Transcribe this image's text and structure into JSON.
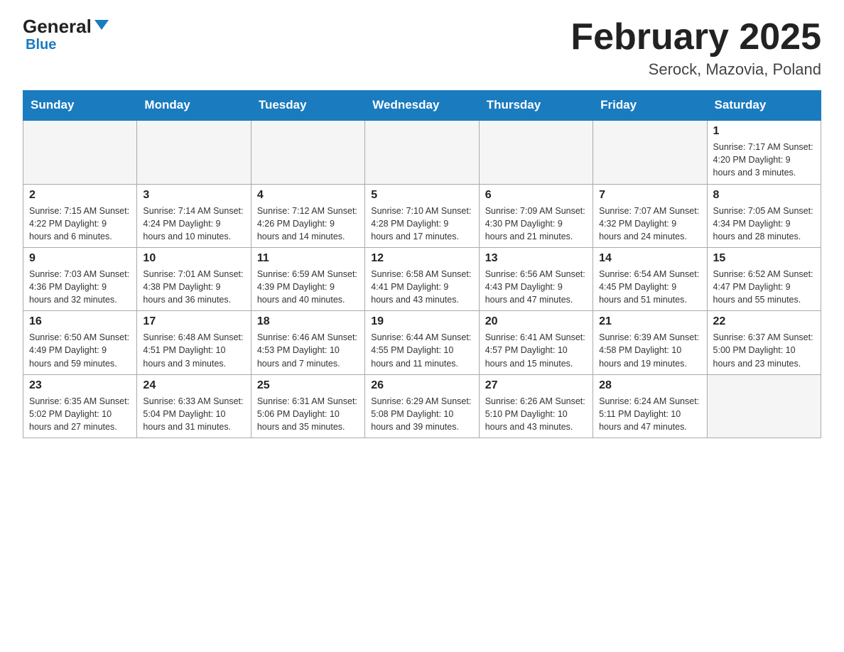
{
  "logo": {
    "name_black": "General",
    "name_blue": "Blue"
  },
  "title": "February 2025",
  "subtitle": "Serock, Mazovia, Poland",
  "days_of_week": [
    "Sunday",
    "Monday",
    "Tuesday",
    "Wednesday",
    "Thursday",
    "Friday",
    "Saturday"
  ],
  "weeks": [
    [
      {
        "day": "",
        "info": ""
      },
      {
        "day": "",
        "info": ""
      },
      {
        "day": "",
        "info": ""
      },
      {
        "day": "",
        "info": ""
      },
      {
        "day": "",
        "info": ""
      },
      {
        "day": "",
        "info": ""
      },
      {
        "day": "1",
        "info": "Sunrise: 7:17 AM\nSunset: 4:20 PM\nDaylight: 9 hours and 3 minutes."
      }
    ],
    [
      {
        "day": "2",
        "info": "Sunrise: 7:15 AM\nSunset: 4:22 PM\nDaylight: 9 hours and 6 minutes."
      },
      {
        "day": "3",
        "info": "Sunrise: 7:14 AM\nSunset: 4:24 PM\nDaylight: 9 hours and 10 minutes."
      },
      {
        "day": "4",
        "info": "Sunrise: 7:12 AM\nSunset: 4:26 PM\nDaylight: 9 hours and 14 minutes."
      },
      {
        "day": "5",
        "info": "Sunrise: 7:10 AM\nSunset: 4:28 PM\nDaylight: 9 hours and 17 minutes."
      },
      {
        "day": "6",
        "info": "Sunrise: 7:09 AM\nSunset: 4:30 PM\nDaylight: 9 hours and 21 minutes."
      },
      {
        "day": "7",
        "info": "Sunrise: 7:07 AM\nSunset: 4:32 PM\nDaylight: 9 hours and 24 minutes."
      },
      {
        "day": "8",
        "info": "Sunrise: 7:05 AM\nSunset: 4:34 PM\nDaylight: 9 hours and 28 minutes."
      }
    ],
    [
      {
        "day": "9",
        "info": "Sunrise: 7:03 AM\nSunset: 4:36 PM\nDaylight: 9 hours and 32 minutes."
      },
      {
        "day": "10",
        "info": "Sunrise: 7:01 AM\nSunset: 4:38 PM\nDaylight: 9 hours and 36 minutes."
      },
      {
        "day": "11",
        "info": "Sunrise: 6:59 AM\nSunset: 4:39 PM\nDaylight: 9 hours and 40 minutes."
      },
      {
        "day": "12",
        "info": "Sunrise: 6:58 AM\nSunset: 4:41 PM\nDaylight: 9 hours and 43 minutes."
      },
      {
        "day": "13",
        "info": "Sunrise: 6:56 AM\nSunset: 4:43 PM\nDaylight: 9 hours and 47 minutes."
      },
      {
        "day": "14",
        "info": "Sunrise: 6:54 AM\nSunset: 4:45 PM\nDaylight: 9 hours and 51 minutes."
      },
      {
        "day": "15",
        "info": "Sunrise: 6:52 AM\nSunset: 4:47 PM\nDaylight: 9 hours and 55 minutes."
      }
    ],
    [
      {
        "day": "16",
        "info": "Sunrise: 6:50 AM\nSunset: 4:49 PM\nDaylight: 9 hours and 59 minutes."
      },
      {
        "day": "17",
        "info": "Sunrise: 6:48 AM\nSunset: 4:51 PM\nDaylight: 10 hours and 3 minutes."
      },
      {
        "day": "18",
        "info": "Sunrise: 6:46 AM\nSunset: 4:53 PM\nDaylight: 10 hours and 7 minutes."
      },
      {
        "day": "19",
        "info": "Sunrise: 6:44 AM\nSunset: 4:55 PM\nDaylight: 10 hours and 11 minutes."
      },
      {
        "day": "20",
        "info": "Sunrise: 6:41 AM\nSunset: 4:57 PM\nDaylight: 10 hours and 15 minutes."
      },
      {
        "day": "21",
        "info": "Sunrise: 6:39 AM\nSunset: 4:58 PM\nDaylight: 10 hours and 19 minutes."
      },
      {
        "day": "22",
        "info": "Sunrise: 6:37 AM\nSunset: 5:00 PM\nDaylight: 10 hours and 23 minutes."
      }
    ],
    [
      {
        "day": "23",
        "info": "Sunrise: 6:35 AM\nSunset: 5:02 PM\nDaylight: 10 hours and 27 minutes."
      },
      {
        "day": "24",
        "info": "Sunrise: 6:33 AM\nSunset: 5:04 PM\nDaylight: 10 hours and 31 minutes."
      },
      {
        "day": "25",
        "info": "Sunrise: 6:31 AM\nSunset: 5:06 PM\nDaylight: 10 hours and 35 minutes."
      },
      {
        "day": "26",
        "info": "Sunrise: 6:29 AM\nSunset: 5:08 PM\nDaylight: 10 hours and 39 minutes."
      },
      {
        "day": "27",
        "info": "Sunrise: 6:26 AM\nSunset: 5:10 PM\nDaylight: 10 hours and 43 minutes."
      },
      {
        "day": "28",
        "info": "Sunrise: 6:24 AM\nSunset: 5:11 PM\nDaylight: 10 hours and 47 minutes."
      },
      {
        "day": "",
        "info": ""
      }
    ]
  ]
}
